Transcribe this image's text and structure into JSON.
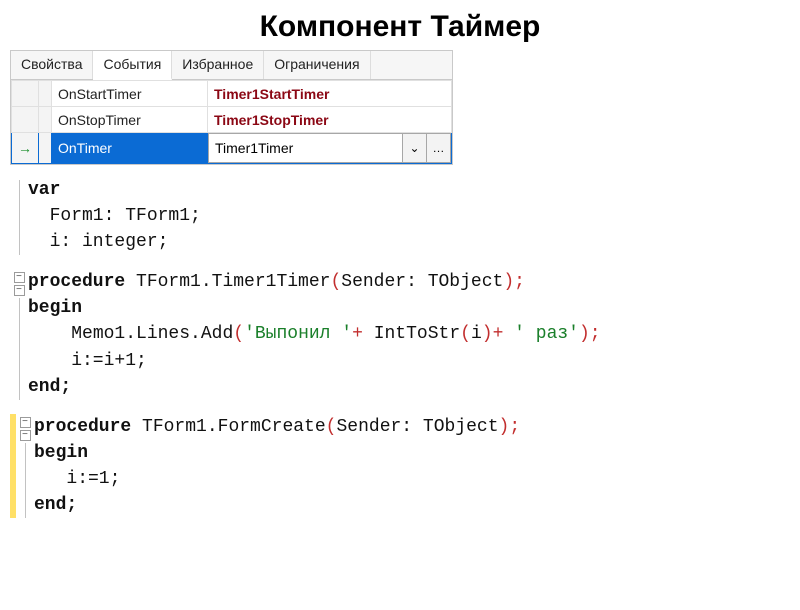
{
  "title": "Компонент Таймер",
  "inspector": {
    "tabs": [
      "Свойства",
      "События",
      "Избранное",
      "Ограничения"
    ],
    "active_tab_index": 1,
    "rows": [
      {
        "arrow": "",
        "name": "OnStartTimer",
        "value": "Timer1StartTimer",
        "selected": false
      },
      {
        "arrow": "",
        "name": "OnStopTimer",
        "value": "Timer1StopTimer",
        "selected": false
      },
      {
        "arrow": "→",
        "name": "OnTimer",
        "value": "Timer1Timer",
        "selected": true
      }
    ],
    "combo_more": "…",
    "combo_chev": "⌄"
  },
  "code": {
    "block1": {
      "l1": "var",
      "l2": "  Form1: TForm1;",
      "l3": "  i: integer;"
    },
    "block2": {
      "sig_kw": "procedure ",
      "sig_rest": "TForm1.Timer1Timer",
      "sig_args_open": "(",
      "sig_args": "Sender: TObject",
      "sig_args_close_punct": ");",
      "begin": "begin",
      "line_indent": "    ",
      "memo_call": "Memo1.Lines.Add",
      "open_p": "(",
      "str1": "'Выпонил '",
      "plus1": "+ ",
      "fn": "IntToStr",
      "open_p2": "(",
      "arg_i": "i",
      "close_p2": ")",
      "plus2": "+ ",
      "str2": "' раз'",
      "close_all": ");",
      "inc": "    i:=i+1;",
      "end": "end;"
    },
    "block3": {
      "sig_kw": "procedure ",
      "sig_rest": "TForm1.FormCreate",
      "sig_args_open": "(",
      "sig_args": "Sender: TObject",
      "sig_args_close_punct": ");",
      "begin": "begin",
      "assign": "   i:=1;",
      "end": "end;"
    }
  }
}
